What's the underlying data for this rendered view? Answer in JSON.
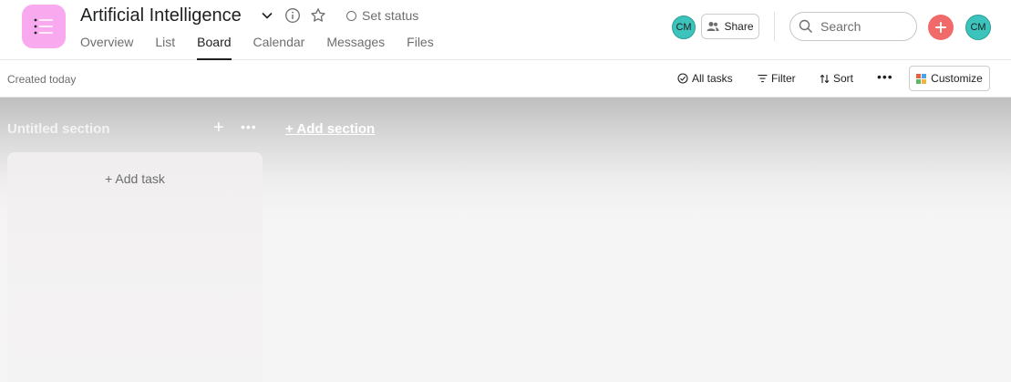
{
  "header": {
    "title": "Artificial Intelligence",
    "set_status": "Set status",
    "tabs": [
      {
        "label": "Overview",
        "active": false
      },
      {
        "label": "List",
        "active": false
      },
      {
        "label": "Board",
        "active": true
      },
      {
        "label": "Calendar",
        "active": false
      },
      {
        "label": "Messages",
        "active": false
      },
      {
        "label": "Files",
        "active": false
      }
    ],
    "member_avatar": "CM",
    "share_label": "Share",
    "search_placeholder": "Search",
    "user_avatar": "CM"
  },
  "toolbar": {
    "created": "Created today",
    "all_tasks": "All tasks",
    "filter": "Filter",
    "sort": "Sort",
    "customize": "Customize"
  },
  "board": {
    "sections": [
      {
        "name": "Untitled section",
        "add_task": "+ Add task"
      }
    ],
    "add_section": "+ Add section"
  },
  "colors": {
    "project_icon": "#f9aaef",
    "accent_add": "#f06a6a",
    "avatar": "#3cc3bb"
  },
  "icons": [
    "project-list-icon",
    "chevron-down-icon",
    "info-icon",
    "star-icon",
    "status-circle-icon",
    "people-icon",
    "search-icon",
    "plus-icon",
    "check-circle-icon",
    "filter-icon",
    "sort-icon",
    "more-icon",
    "customize-grid-icon"
  ]
}
